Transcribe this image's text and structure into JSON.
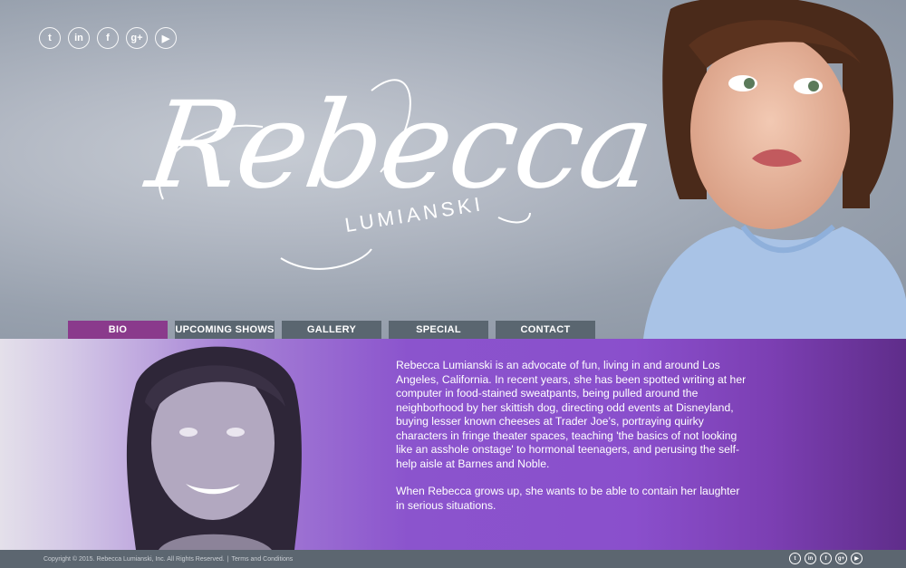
{
  "social": [
    {
      "name": "twitter-icon",
      "glyph": "t"
    },
    {
      "name": "linkedin-icon",
      "glyph": "in"
    },
    {
      "name": "facebook-icon",
      "glyph": "f"
    },
    {
      "name": "google-plus-icon",
      "glyph": "g+"
    },
    {
      "name": "youtube-icon",
      "glyph": "▶"
    }
  ],
  "logo": {
    "script": "Rebecca",
    "surname": "LUMIANSKI"
  },
  "nav": [
    {
      "label": "BIO",
      "active": true
    },
    {
      "label": "UPCOMING SHOWS",
      "active": false
    },
    {
      "label": "GALLERY",
      "active": false
    },
    {
      "label": "SPECIAL",
      "active": false
    },
    {
      "label": "CONTACT",
      "active": false
    }
  ],
  "bio": {
    "paragraph1": "Rebecca Lumianski is an advocate of fun, living in and around Los Angeles, California. In recent years, she has been spotted writing at her computer in food-stained sweatpants, being pulled around the neighborhood by her skittish dog, directing odd events at Disneyland, buying lesser known cheeses at Trader Joe’s, portraying quirky characters in fringe theater spaces, teaching 'the basics of not looking like an asshole onstage' to hormonal teenagers, and perusing the self-help aisle at Barnes and Noble.",
    "paragraph2": "When Rebecca grows up, she wants to be able to contain her laughter in serious situations."
  },
  "footer": {
    "copyright": "Copyright © 2015. Rebecca Lumianski, Inc. All Rights Reserved.",
    "separator": "|",
    "terms": "Terms and Conditions"
  },
  "colors": {
    "active_tab": "#8a3a8c",
    "tab": "#5a6670",
    "footer": "#5c6670",
    "purple": "#8a4fcc"
  }
}
